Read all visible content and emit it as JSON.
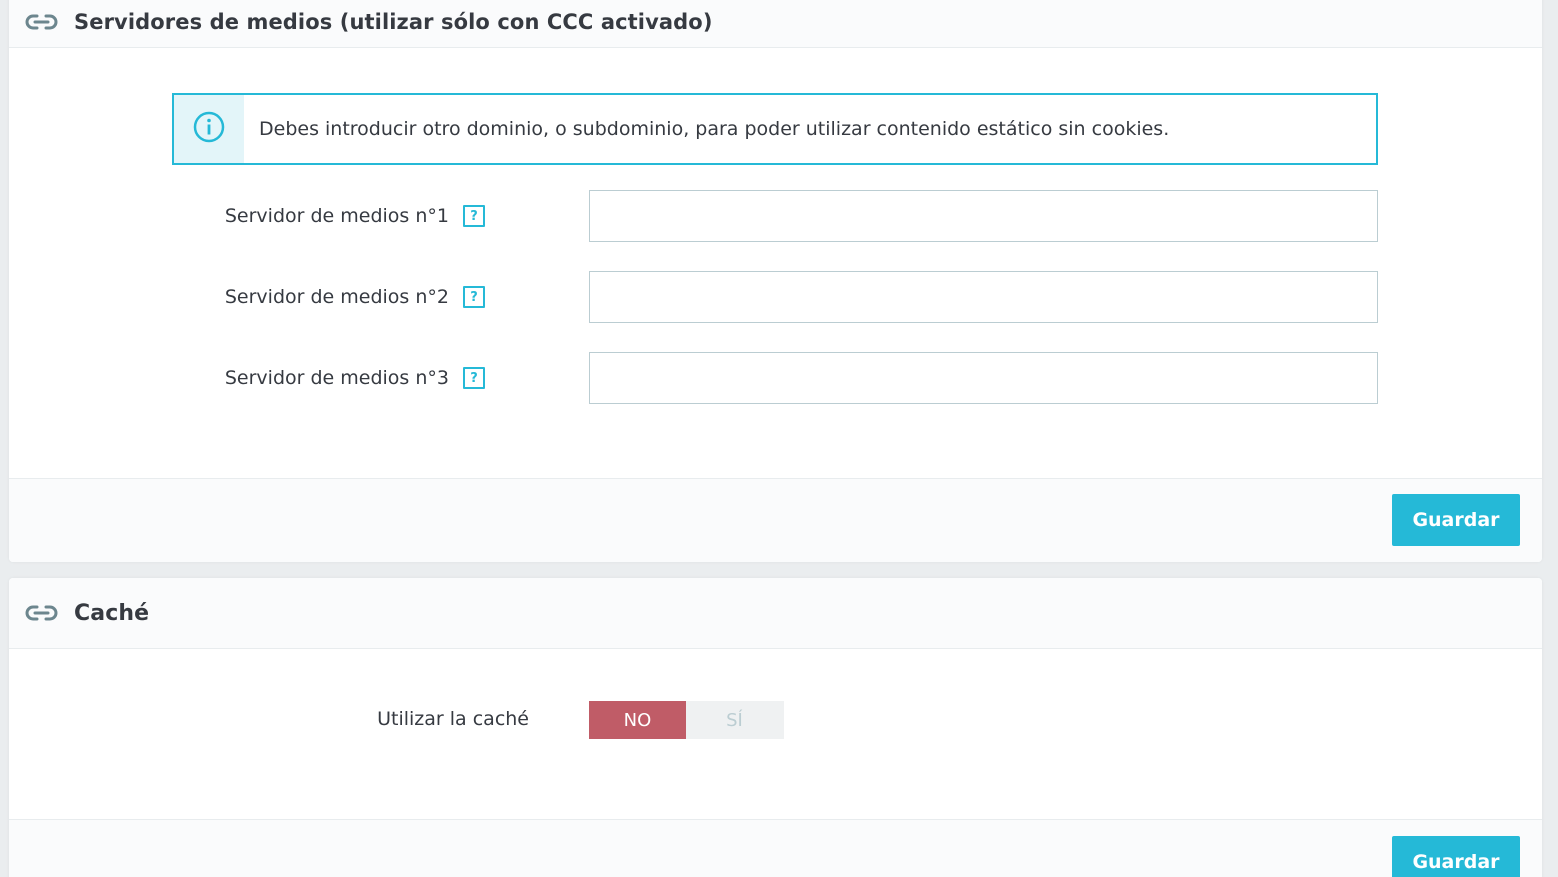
{
  "media_servers": {
    "title": "Servidores de medios (utilizar sólo con CCC activado)",
    "icon": "link-icon",
    "alert": {
      "icon": "info-icon",
      "text": "Debes introducir otro dominio, o subdominio, para poder utilizar contenido estático sin cookies."
    },
    "fields": [
      {
        "label": "Servidor de medios n°1",
        "help": "?",
        "value": ""
      },
      {
        "label": "Servidor de medios n°2",
        "help": "?",
        "value": ""
      },
      {
        "label": "Servidor de medios n°3",
        "help": "?",
        "value": ""
      }
    ],
    "save_label": "Guardar"
  },
  "cache": {
    "title": "Caché",
    "icon": "link-icon",
    "use_cache_label": "Utilizar la caché",
    "switch": {
      "no_label": "NO",
      "yes_label": "SÍ",
      "selected": "NO"
    },
    "save_label": "Guardar"
  },
  "colors": {
    "accent": "#25b9d7",
    "switch_off": "#c05c67",
    "border": "#bbcdd2"
  }
}
